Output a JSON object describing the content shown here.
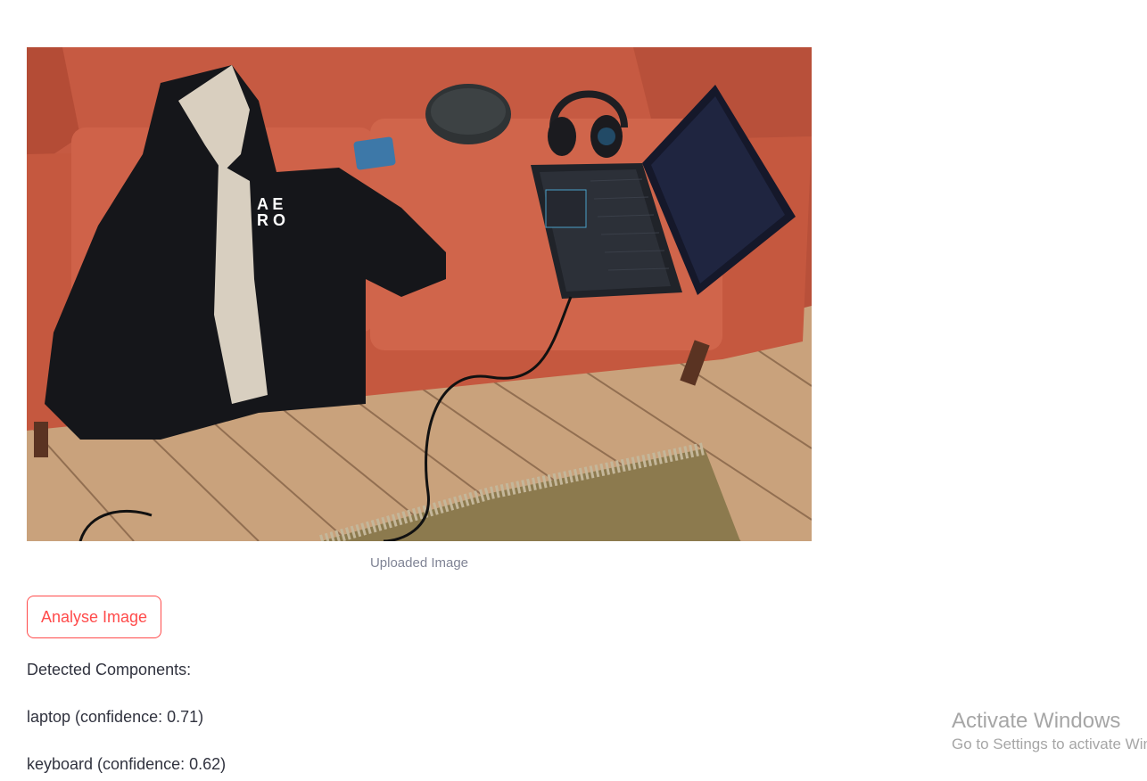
{
  "image": {
    "caption": "Uploaded Image"
  },
  "actions": {
    "analyse_label": "Analyse Image"
  },
  "results": {
    "heading": "Detected Components:",
    "detections": [
      "laptop (confidence: 0.71)",
      "keyboard (confidence: 0.62)"
    ]
  },
  "watermark": {
    "title": "Activate Windows",
    "subtitle": "Go to Settings to activate Windows."
  },
  "colors": {
    "accent": "#ff4b4b",
    "text": "#31333f",
    "caption": "#808495"
  }
}
